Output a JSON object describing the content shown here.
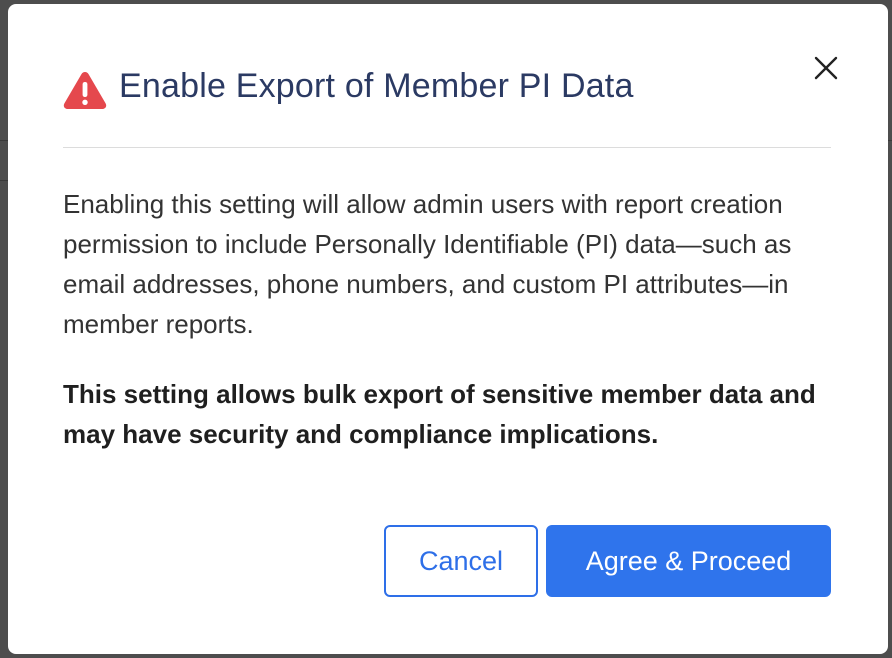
{
  "dialog": {
    "title": "Enable Export of Member PI Data",
    "icon": "warning-triangle-icon",
    "close_icon": "close-icon",
    "description": "Enabling this setting will allow admin users with report creation permission to include Personally Identifiable (PI) data—such as email addresses, phone numbers, and custom PI attributes—in member reports.",
    "warning": "This setting allows bulk export of sensitive member data and may have security and compliance implications.",
    "cancel_label": "Cancel",
    "agree_label": "Agree & Proceed"
  },
  "colors": {
    "title": "#2b3a63",
    "warning_icon": "#e5484d",
    "primary": "#2f74ec",
    "text": "#333333"
  }
}
